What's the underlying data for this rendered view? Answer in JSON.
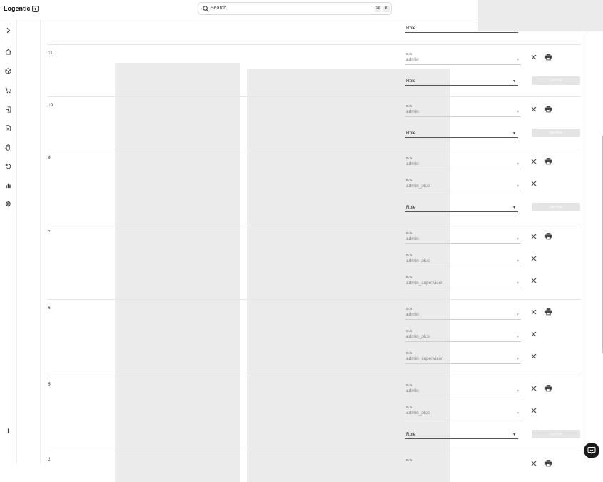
{
  "app": {
    "title": "Logentic"
  },
  "search": {
    "label": "Search",
    "shortcut_cmd": "⌘",
    "shortcut_key": "K"
  },
  "sidebar": {
    "items": [
      {
        "icon": "chevron-right-icon"
      },
      {
        "icon": "home-icon"
      },
      {
        "icon": "package-icon"
      },
      {
        "icon": "cart-icon"
      },
      {
        "icon": "login-icon"
      },
      {
        "icon": "document-icon"
      },
      {
        "icon": "hand-icon"
      },
      {
        "icon": "undo-icon"
      },
      {
        "icon": "bar-chart-icon"
      },
      {
        "icon": "gear-icon"
      },
      {
        "icon": "plus-icon"
      }
    ]
  },
  "table": {
    "role_label": "Role",
    "add_role_label": "Add Role",
    "top_partial": {
      "new_role_label": "Role"
    },
    "rows": [
      {
        "id": "11",
        "roles": [
          "admin"
        ],
        "new_role_label": "Role"
      },
      {
        "id": "10",
        "roles": [
          "admin"
        ],
        "new_role_label": "Role"
      },
      {
        "id": "8",
        "roles": [
          "admin",
          "admin_plus"
        ],
        "new_role_label": "Role"
      },
      {
        "id": "7",
        "roles": [
          "admin",
          "admin_plus",
          "admin_supervisor"
        ]
      },
      {
        "id": "6",
        "roles": [
          "admin",
          "admin_plus",
          "admin_supervisor"
        ]
      },
      {
        "id": "5",
        "roles": [
          "admin",
          "admin_plus"
        ],
        "new_role_label": "Role"
      },
      {
        "id": "2",
        "roles": [
          "admin"
        ]
      }
    ]
  }
}
